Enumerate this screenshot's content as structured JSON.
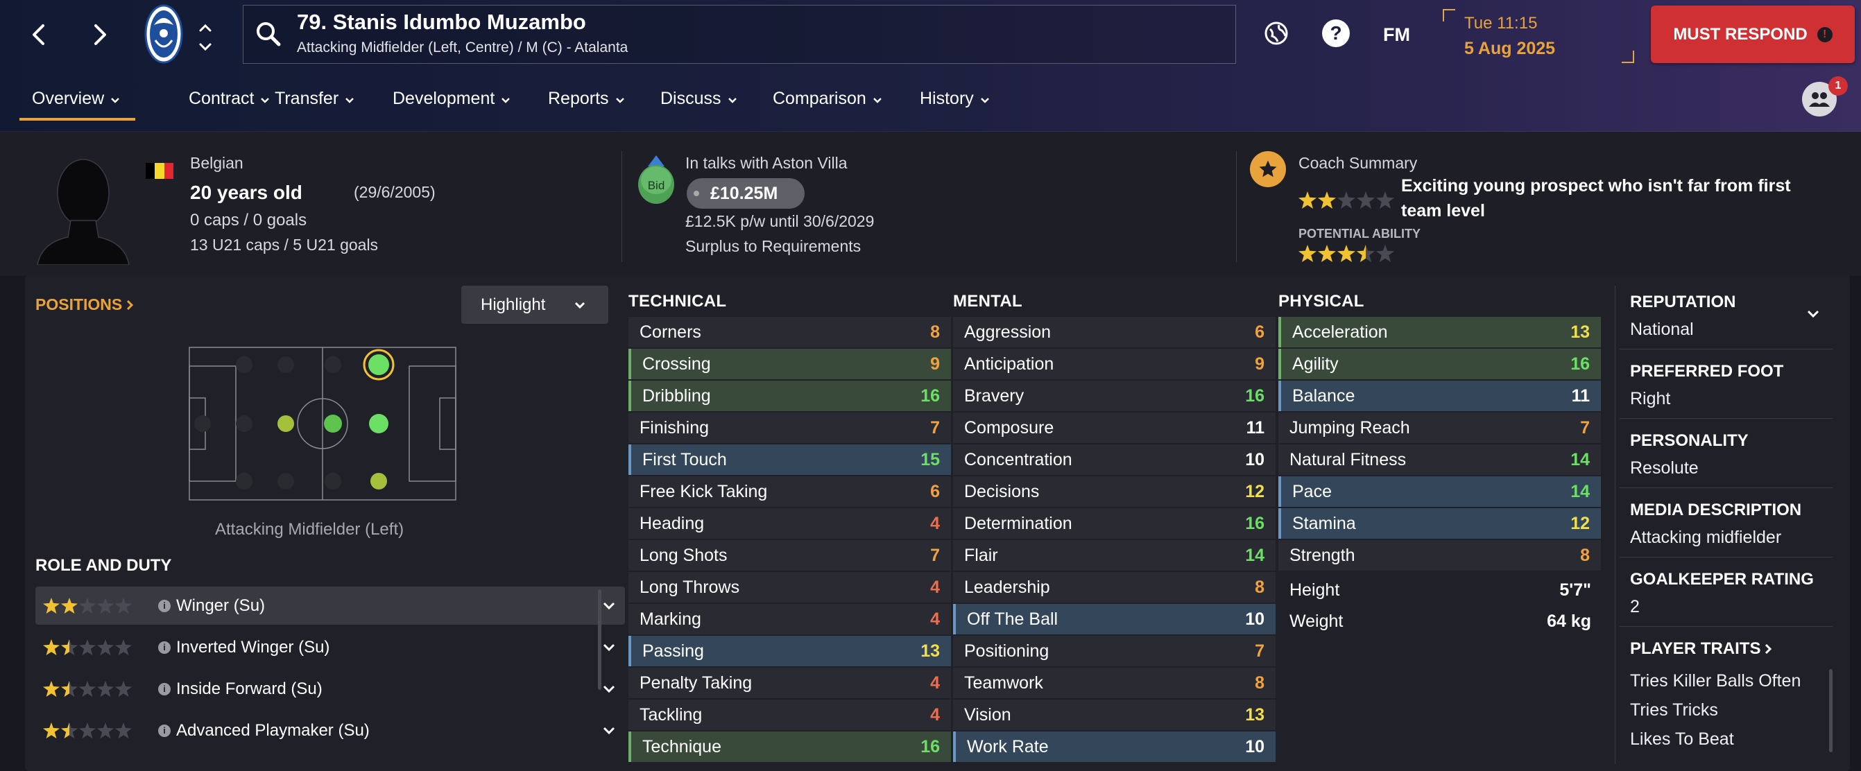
{
  "header": {
    "player_name": "79. Stanis Idumbo Muzambo",
    "player_subtitle": "Attacking Midfielder (Left, Centre) / M (C) - Atalanta",
    "fm_label": "FM",
    "day_time": "Tue 11:15",
    "date": "5 Aug 2025",
    "must_respond": "MUST RESPOND",
    "notification_count": "1",
    "icons": [
      "back-arrow-icon",
      "forward-arrow-icon",
      "club-crest-icon",
      "search-icon",
      "globe-icon",
      "help-icon",
      "warning-icon",
      "inbox-people-icon"
    ],
    "accent": "#e8a33c",
    "alert_color": "#cf3033"
  },
  "nav": {
    "tabs": [
      "Overview",
      "Contract",
      "Transfer",
      "Development",
      "Reports",
      "Discuss",
      "Comparison",
      "History"
    ]
  },
  "profile": {
    "nationality": "Belgian",
    "age": "20 years old",
    "dob": "(29/6/2005)",
    "caps": "0 caps / 0 goals",
    "u21_caps": "13 U21 caps / 5 U21 goals"
  },
  "transfer": {
    "status": "In talks with Aston Villa",
    "bid_label": "Bid",
    "value": "£10.25M",
    "wage": "£12.5K p/w until 30/6/2029",
    "squad_status": "Surplus to Requirements"
  },
  "coach": {
    "title": "Coach Summary",
    "summary_line1": "Exciting young prospect who isn't far from first",
    "summary_line2": "team level",
    "current_ability_stars": 2,
    "potential_label": "POTENTIAL ABILITY",
    "potential_ability_stars": 3.5
  },
  "positions": {
    "title": "POSITIONS",
    "highlight_label": "Highlight",
    "selected_position": "Attacking Midfielder (Left)"
  },
  "roles": {
    "title": "ROLE AND DUTY",
    "items": [
      {
        "label": "Winger (Su)",
        "stars": 2
      },
      {
        "label": "Inverted Winger (Su)",
        "stars": 1.5
      },
      {
        "label": "Inside Forward (Su)",
        "stars": 1.5
      },
      {
        "label": "Advanced Playmaker (Su)",
        "stars": 1.5
      }
    ]
  },
  "technical": {
    "title": "TECHNICAL",
    "items": [
      {
        "name": "Corners",
        "value": "8",
        "hl": "none"
      },
      {
        "name": "Crossing",
        "value": "9",
        "hl": "g"
      },
      {
        "name": "Dribbling",
        "value": "16",
        "hl": "g"
      },
      {
        "name": "Finishing",
        "value": "7",
        "hl": "none"
      },
      {
        "name": "First Touch",
        "value": "15",
        "hl": "b"
      },
      {
        "name": "Free Kick Taking",
        "value": "6",
        "hl": "none"
      },
      {
        "name": "Heading",
        "value": "4",
        "hl": "none"
      },
      {
        "name": "Long Shots",
        "value": "7",
        "hl": "none"
      },
      {
        "name": "Long Throws",
        "value": "4",
        "hl": "none"
      },
      {
        "name": "Marking",
        "value": "4",
        "hl": "none"
      },
      {
        "name": "Passing",
        "value": "13",
        "hl": "b"
      },
      {
        "name": "Penalty Taking",
        "value": "4",
        "hl": "none"
      },
      {
        "name": "Tackling",
        "value": "4",
        "hl": "none"
      },
      {
        "name": "Technique",
        "value": "16",
        "hl": "g"
      }
    ]
  },
  "mental": {
    "title": "MENTAL",
    "items": [
      {
        "name": "Aggression",
        "value": "6",
        "hl": "none"
      },
      {
        "name": "Anticipation",
        "value": "9",
        "hl": "none"
      },
      {
        "name": "Bravery",
        "value": "16",
        "hl": "none"
      },
      {
        "name": "Composure",
        "value": "11",
        "hl": "none"
      },
      {
        "name": "Concentration",
        "value": "10",
        "hl": "none"
      },
      {
        "name": "Decisions",
        "value": "12",
        "hl": "none"
      },
      {
        "name": "Determination",
        "value": "16",
        "hl": "none"
      },
      {
        "name": "Flair",
        "value": "14",
        "hl": "none"
      },
      {
        "name": "Leadership",
        "value": "8",
        "hl": "none"
      },
      {
        "name": "Off The Ball",
        "value": "10",
        "hl": "b"
      },
      {
        "name": "Positioning",
        "value": "7",
        "hl": "none"
      },
      {
        "name": "Teamwork",
        "value": "8",
        "hl": "none"
      },
      {
        "name": "Vision",
        "value": "13",
        "hl": "none"
      },
      {
        "name": "Work Rate",
        "value": "10",
        "hl": "b"
      }
    ]
  },
  "physical": {
    "title": "PHYSICAL",
    "items": [
      {
        "name": "Acceleration",
        "value": "13",
        "hl": "g"
      },
      {
        "name": "Agility",
        "value": "16",
        "hl": "g"
      },
      {
        "name": "Balance",
        "value": "11",
        "hl": "b"
      },
      {
        "name": "Jumping Reach",
        "value": "7",
        "hl": "none"
      },
      {
        "name": "Natural Fitness",
        "value": "14",
        "hl": "none"
      },
      {
        "name": "Pace",
        "value": "14",
        "hl": "b"
      },
      {
        "name": "Stamina",
        "value": "12",
        "hl": "b"
      },
      {
        "name": "Strength",
        "value": "8",
        "hl": "none"
      }
    ],
    "height_label": "Height",
    "height": "5'7\"",
    "weight_label": "Weight",
    "weight": "64 kg"
  },
  "info": {
    "reputation_label": "REPUTATION",
    "reputation": "National",
    "foot_label": "PREFERRED FOOT",
    "foot": "Right",
    "personality_label": "PERSONALITY",
    "personality": "Resolute",
    "media_label": "MEDIA DESCRIPTION",
    "media": "Attacking midfielder",
    "gk_label": "GOALKEEPER RATING",
    "gk": "2",
    "traits_label": "PLAYER TRAITS",
    "traits": [
      "Tries Killer Balls Often",
      "Tries Tricks",
      "Likes To Beat"
    ]
  }
}
